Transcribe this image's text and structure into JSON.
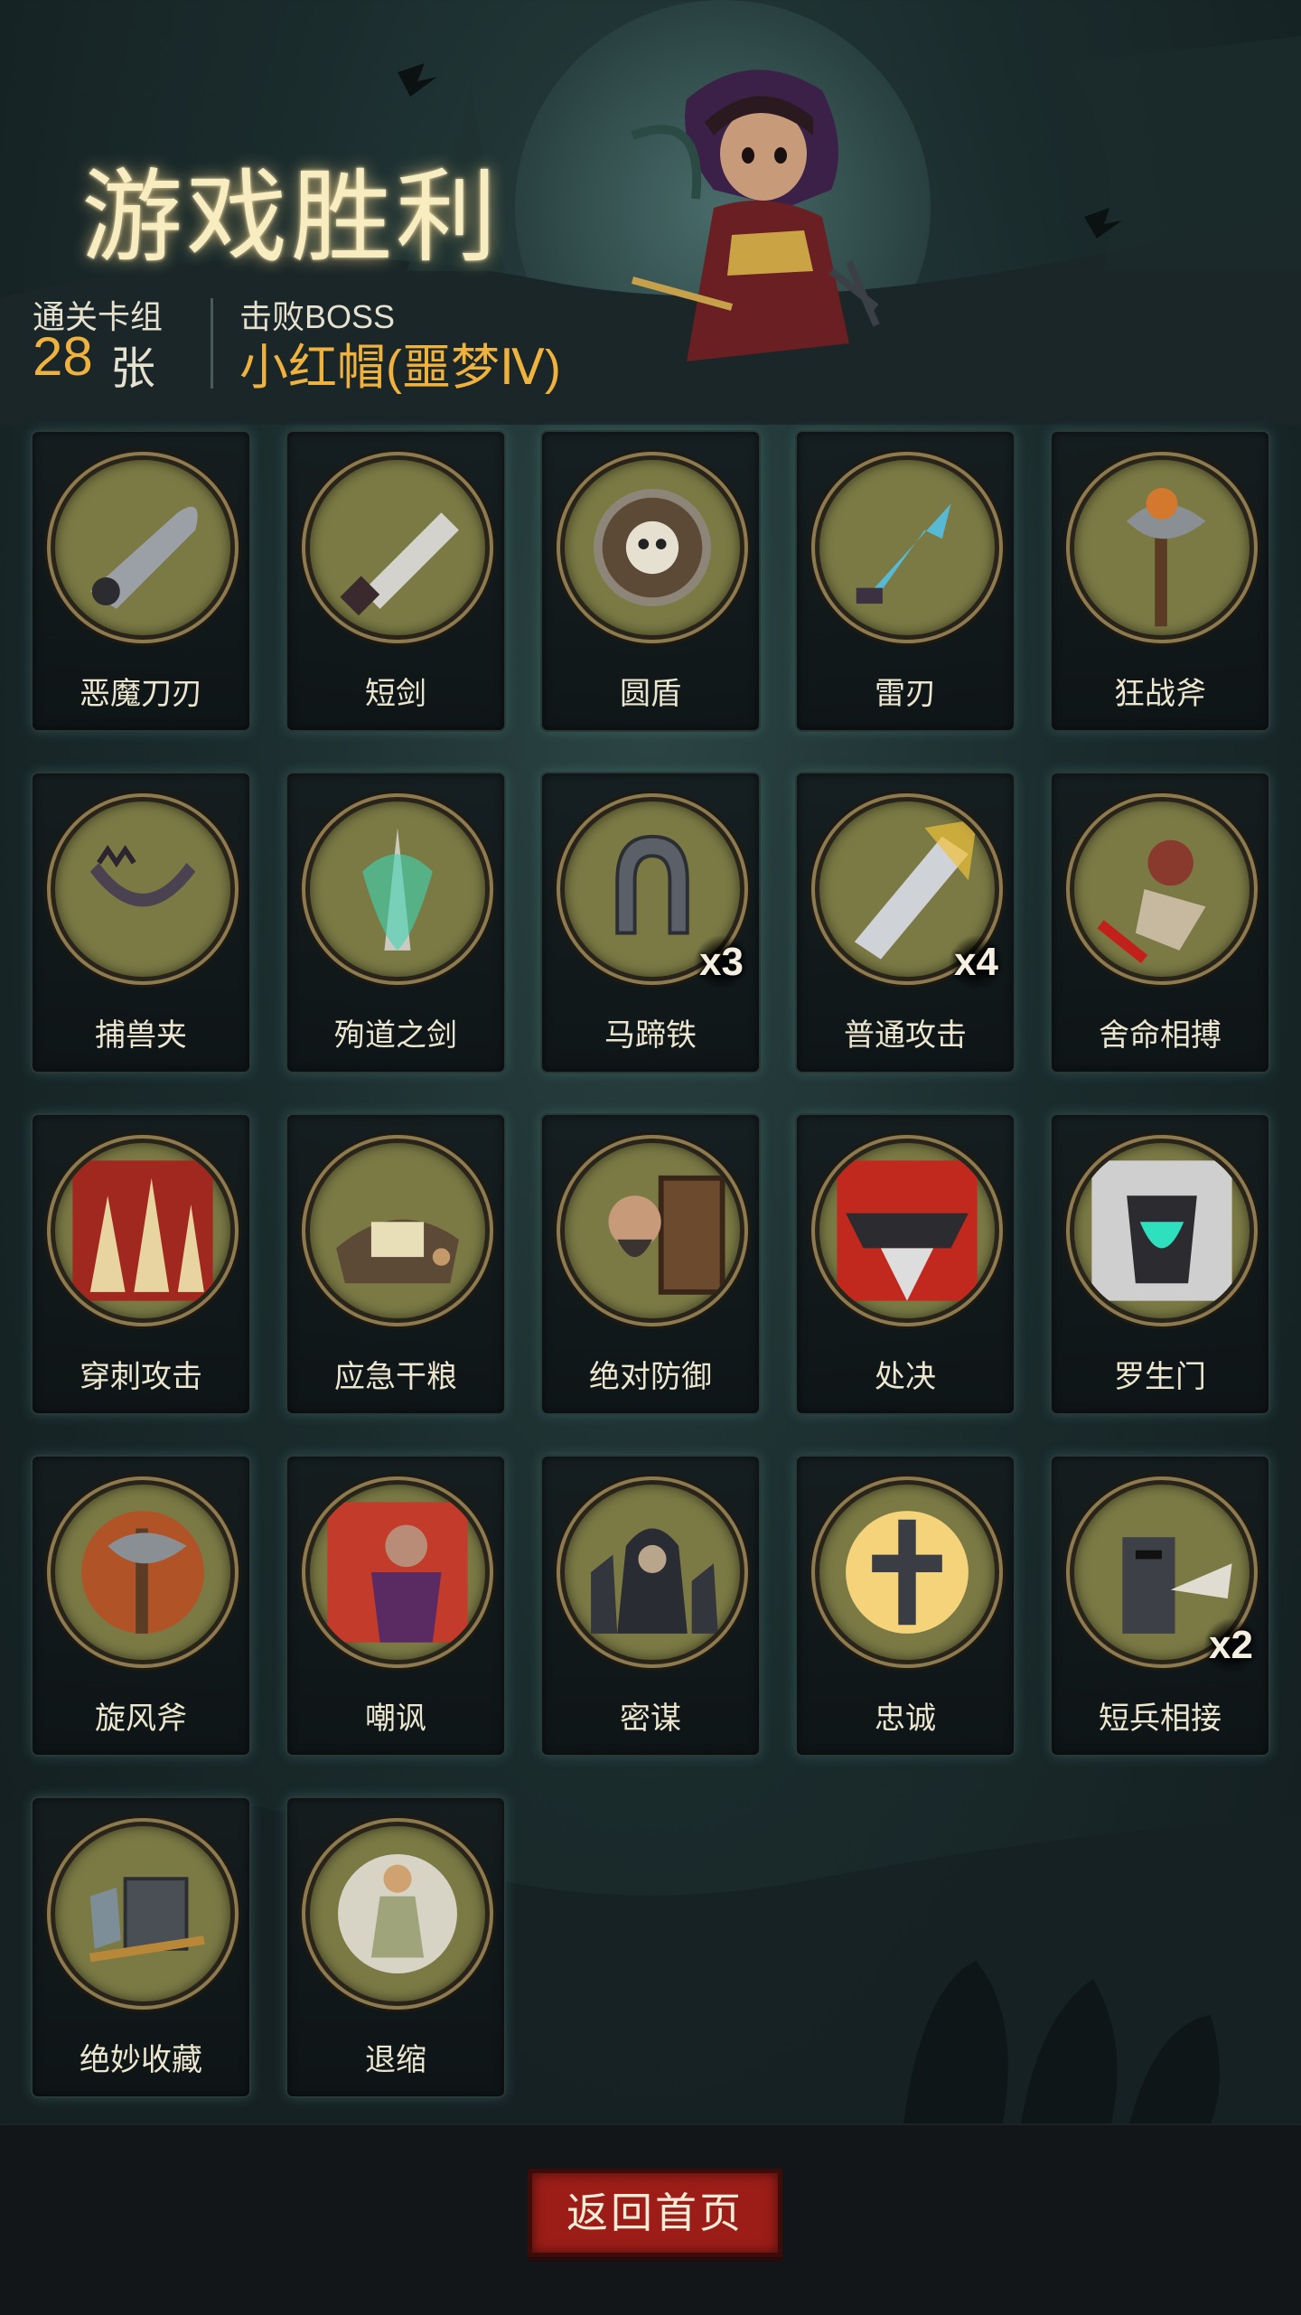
{
  "title": "游戏胜利",
  "stats": {
    "deck_label": "通关卡组",
    "deck_count": "28",
    "deck_unit": "张",
    "boss_label": "击败BOSS",
    "boss_name": "小红帽(噩梦Ⅳ)"
  },
  "cards": [
    {
      "label": "恶魔刀刃",
      "icon": "demon-blade-icon",
      "count": ""
    },
    {
      "label": "短剑",
      "icon": "short-sword-icon",
      "count": ""
    },
    {
      "label": "圆盾",
      "icon": "round-shield-icon",
      "count": ""
    },
    {
      "label": "雷刃",
      "icon": "thunder-blade-icon",
      "count": ""
    },
    {
      "label": "狂战斧",
      "icon": "berserker-axe-icon",
      "count": ""
    },
    {
      "label": "捕兽夹",
      "icon": "bear-trap-icon",
      "count": ""
    },
    {
      "label": "殉道之剑",
      "icon": "martyr-sword-icon",
      "count": ""
    },
    {
      "label": "马蹄铁",
      "icon": "horseshoe-icon",
      "count": "x3"
    },
    {
      "label": "普通攻击",
      "icon": "basic-attack-icon",
      "count": "x4"
    },
    {
      "label": "舍命相搏",
      "icon": "desperate-fight-icon",
      "count": ""
    },
    {
      "label": "穿刺攻击",
      "icon": "pierce-attack-icon",
      "count": ""
    },
    {
      "label": "应急干粮",
      "icon": "emergency-rations-icon",
      "count": ""
    },
    {
      "label": "绝对防御",
      "icon": "absolute-defense-icon",
      "count": ""
    },
    {
      "label": "处决",
      "icon": "execution-icon",
      "count": ""
    },
    {
      "label": "罗生门",
      "icon": "rashomon-icon",
      "count": ""
    },
    {
      "label": "旋风斧",
      "icon": "whirlwind-axe-icon",
      "count": ""
    },
    {
      "label": "嘲讽",
      "icon": "taunt-icon",
      "count": ""
    },
    {
      "label": "密谋",
      "icon": "conspiracy-icon",
      "count": ""
    },
    {
      "label": "忠诚",
      "icon": "loyalty-cross-icon",
      "count": ""
    },
    {
      "label": "短兵相接",
      "icon": "close-combat-icon",
      "count": "x2"
    },
    {
      "label": "绝妙收藏",
      "icon": "fine-collection-icon",
      "count": ""
    },
    {
      "label": "退缩",
      "icon": "retreat-icon",
      "count": ""
    }
  ],
  "footer": {
    "home_button": "返回首页"
  }
}
